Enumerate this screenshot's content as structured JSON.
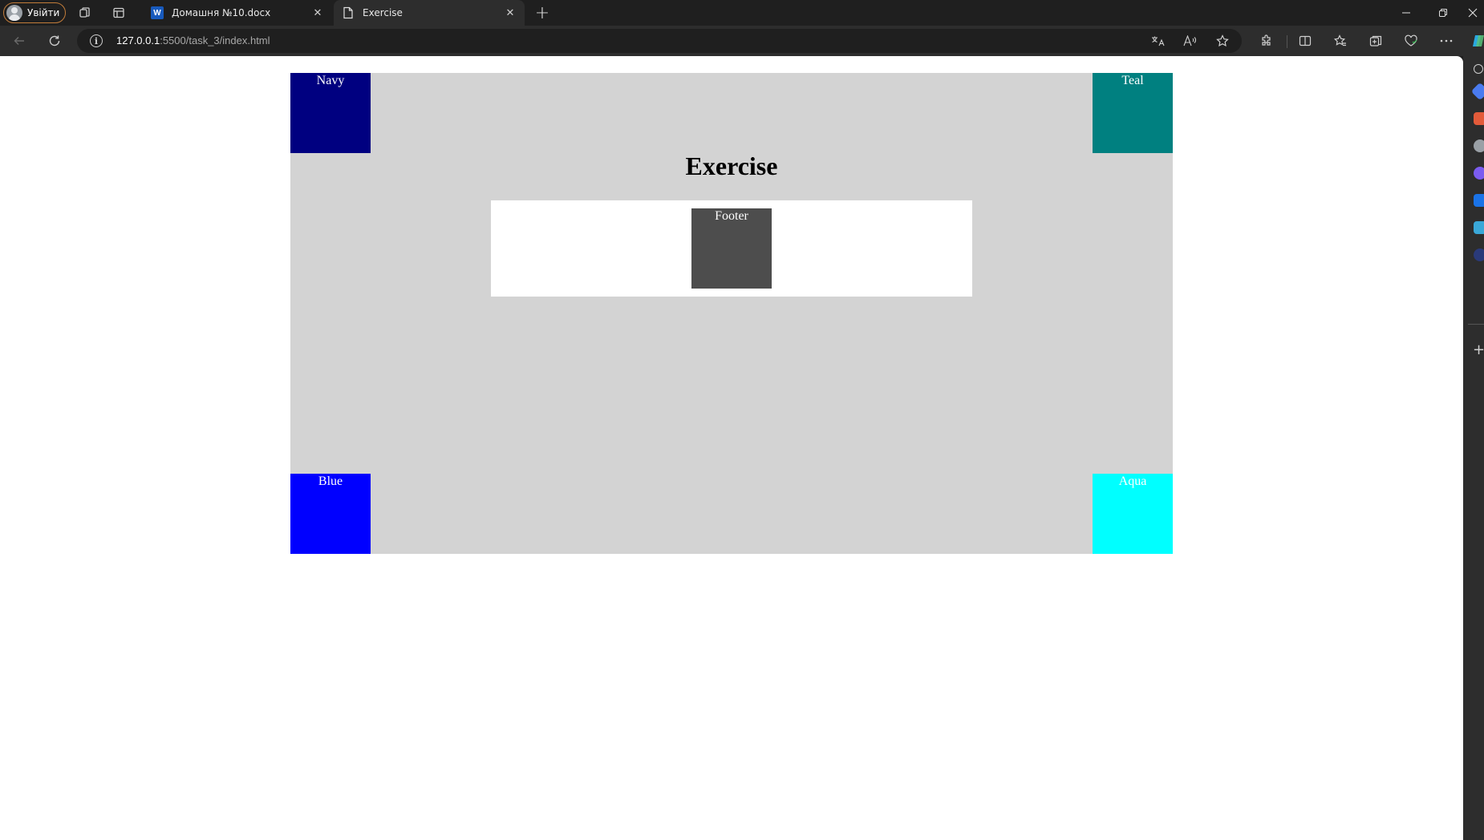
{
  "browser": {
    "profile_label": "Увійти",
    "tabs": [
      {
        "title": "Домашня №10.docx",
        "favicon": "word-icon",
        "active": false
      },
      {
        "title": "Exercise",
        "favicon": "page-icon",
        "active": true
      }
    ],
    "address": {
      "host": "127.0.0.1",
      "rest": ":5500/task_3/index.html"
    },
    "word_favicon_letter": "W",
    "accent_color": "#c27c3a"
  },
  "page": {
    "title": "Exercise",
    "corners": {
      "top_left": {
        "label": "Navy",
        "color": "#000080"
      },
      "top_right": {
        "label": "Teal",
        "color": "#008080"
      },
      "bottom_left": {
        "label": "Blue",
        "color": "#0000ff"
      },
      "bottom_right": {
        "label": "Aqua",
        "color": "#00ffff"
      }
    },
    "footer_label": "Footer",
    "container_color": "#d3d3d3",
    "footer_color": "#4d4d4d"
  }
}
